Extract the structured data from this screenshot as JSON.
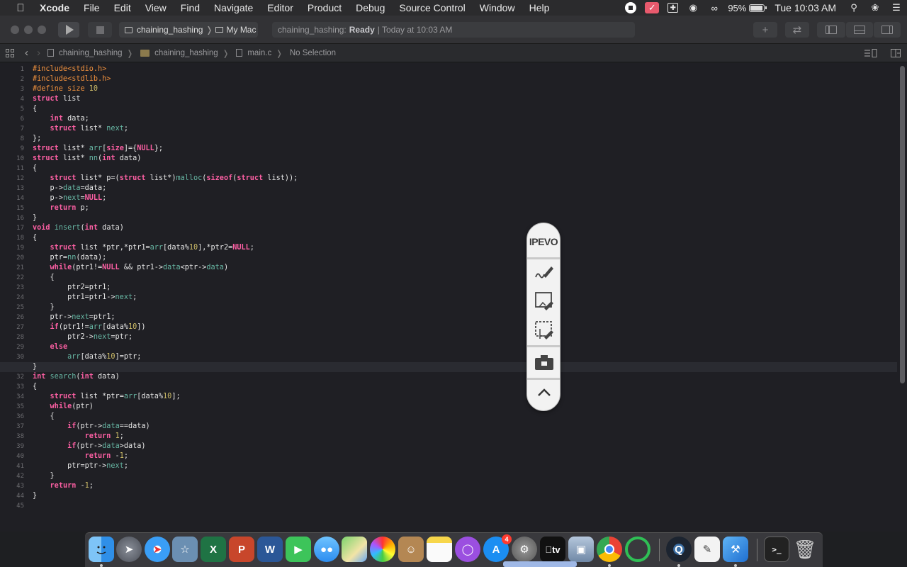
{
  "menubar": {
    "app_name": "Xcode",
    "items": [
      "File",
      "Edit",
      "View",
      "Find",
      "Navigate",
      "Editor",
      "Product",
      "Debug",
      "Source Control",
      "Window",
      "Help"
    ],
    "battery": "95%",
    "clock": "Tue 10:03 AM"
  },
  "toolbar": {
    "scheme_project": "chaining_hashing",
    "scheme_device": "My Mac",
    "activity_prefix": "chaining_hashing:",
    "activity_status": "Ready",
    "activity_time": "| Today at 10:03 AM"
  },
  "jumpbar": {
    "crumbs": [
      "chaining_hashing",
      "chaining_hashing",
      "main.c",
      "No Selection"
    ]
  },
  "editor": {
    "current_line": 31,
    "line_numbers": [
      "1",
      "2",
      "3",
      "4",
      "5",
      "6",
      "7",
      "8",
      "9",
      "10",
      "11",
      "12",
      "13",
      "14",
      "15",
      "16",
      "17",
      "18",
      "19",
      "20",
      "21",
      "22",
      "23",
      "24",
      "25",
      "26",
      "27",
      "28",
      "29",
      "30",
      "31",
      "32",
      "33",
      "34",
      "35",
      "36",
      "37",
      "38",
      "39",
      "40",
      "41",
      "42",
      "43",
      "44",
      "45"
    ],
    "lines": [
      "#include<stdio.h>",
      "#include<stdlib.h>",
      "#define size 10",
      "struct list",
      "{",
      "    int data;",
      "    struct list* next;",
      "};",
      "struct list* arr[size]={NULL};",
      "struct list* nn(int data)",
      "{",
      "    struct list* p=(struct list*)malloc(sizeof(struct list));",
      "    p->data=data;",
      "    p->next=NULL;",
      "    return p;",
      "}",
      "void insert(int data)",
      "{",
      "    struct list *ptr,*ptr1=arr[data%10],*ptr2=NULL;",
      "    ptr=nn(data);",
      "    while(ptr1!=NULL && ptr1->data<ptr->data)",
      "    {",
      "        ptr2=ptr1;",
      "        ptr1=ptr1->next;",
      "    }",
      "    ptr->next=ptr1;",
      "    if(ptr1!=arr[data%10])",
      "        ptr2->next=ptr;",
      "    else",
      "        arr[data%10]=ptr;",
      "}",
      "int search(int data)",
      "{",
      "    struct list *ptr=arr[data%10];",
      "    while(ptr)",
      "    {",
      "        if(ptr->data==data)",
      "            return 1;",
      "        if(ptr->data>data)",
      "            return -1;",
      "        ptr=ptr->next;",
      "    }",
      "    return -1;",
      "}",
      ""
    ]
  },
  "ipevo": {
    "logo": "IPEVO"
  },
  "dock": {
    "excel_letter": "X",
    "powerpoint_letter": "P",
    "word_letter": "W",
    "appstore_badge": "4",
    "appletv_label": "tv",
    "icons": [
      "finder-icon",
      "launchpad-icon",
      "safari-icon",
      "preview-icon",
      "excel-icon",
      "powerpoint-icon",
      "word-icon",
      "facetime-icon",
      "messages-icon",
      "maps-icon",
      "photos-icon",
      "contacts-icon",
      "notes-icon",
      "podcasts-icon",
      "appstore-icon",
      "system-preferences-icon",
      "appletv-icon",
      "image-capture-icon",
      "chrome-icon",
      "circle-app-icon",
      "quicktime-icon",
      "textedit-icon",
      "xcode-icon",
      "terminal-icon",
      "trash-icon"
    ]
  }
}
